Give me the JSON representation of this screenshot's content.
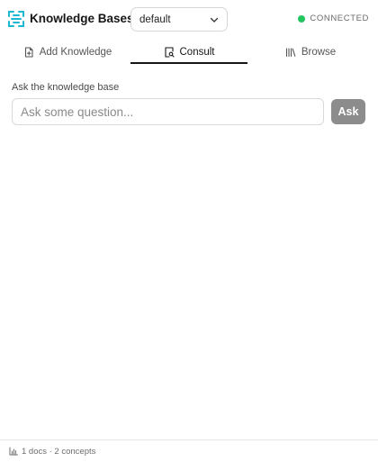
{
  "header": {
    "title": "Knowledge Bases",
    "logo_icon": "knowledge-base-logo-icon",
    "accent_color": "#1bb8d1",
    "kb_select": {
      "value": "default",
      "icon": "chevron-down-icon"
    },
    "status": {
      "label": "CONNECTED",
      "color": "#22c55e"
    }
  },
  "tabs": [
    {
      "label": "Add Knowledge",
      "icon": "file-plus-icon",
      "active": false
    },
    {
      "label": "Consult",
      "icon": "search-document-icon",
      "active": true
    },
    {
      "label": "Browse",
      "icon": "library-icon",
      "active": false
    }
  ],
  "consult": {
    "field_label": "Ask the knowledge base",
    "placeholder": "Ask some question...",
    "value": "",
    "ask_label": "Ask"
  },
  "footer": {
    "stats_icon": "bar-chart-icon",
    "text": "1 docs · 2 concepts"
  }
}
